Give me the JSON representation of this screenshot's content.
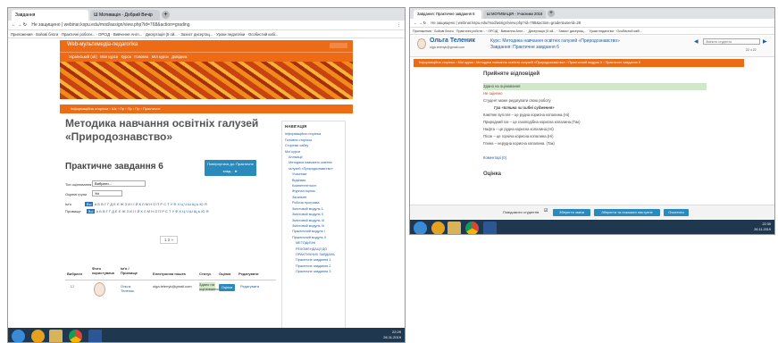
{
  "left": {
    "tabs": [
      "Завдання",
      "Ш Мотивація - Добрий Вечір"
    ],
    "url": "Не защищено | webinar.kspu.edu/mod/assign/view.php?id=768&action=grading",
    "bookmarks": [
      "Приложения",
      "Бойові блоги",
      "Практичні роботи...",
      "ОРСІД",
      "Вивчення Англ...",
      "Дисертація (5 ой...",
      "Захист дисертац...",
      "Уроки педагогіки",
      "Особистий кабі..."
    ],
    "site_title": "Web-мультимедіа-педагогіка",
    "nav": [
      "Український (uk)",
      "Моя курси",
      "Курси",
      "Головна",
      "Мої курси",
      "Довідник"
    ],
    "section_bar": [
      "Інформаційна сторінка",
      "Шк",
      "Пр",
      "Пр",
      "Пр",
      "Практичне"
    ],
    "course_title_1": "Методика навчання освітніх галузей",
    "course_title_2": "«Природознавство»",
    "assign_title": "Практичне завдання 6",
    "grade_button": "Повернутися до: Практичне завд... ►",
    "filter_label": "Тип оцінювання",
    "filter_value": "Вибрати...",
    "group_label": "Окремі групи",
    "group_value": "Усі",
    "firstname_label": "Ім'я",
    "surname_label": "Прізвище",
    "all_label": "Всі",
    "letters": "А Б В Г Ґ Д Е Є Ж З И І Ї Й К Л М Н О П Р С Т У Ф Х Ц Ч Ш Щ Ь Ю Я",
    "pager": "1  2  »",
    "table_headers": [
      "Вибрати",
      "Фото користувача",
      "Ім'я / Прізвище",
      "Електронна пошта",
      "Статус",
      "Оцінка",
      "Редагувати"
    ],
    "row": {
      "name": "Ольга Теленик",
      "email": "olga.telenyk@gmail.com",
      "status": "Здано на оцінювання",
      "grade_button": "Оцінка",
      "edit": "Редагувати"
    },
    "nav_block_title": "НАВІГАЦІЯ",
    "nav_block": [
      "Інформаційна сторінка",
      "Головна сторінка",
      "Сторінки сайту",
      "Мої курси",
      "Аплікації",
      "Методика навчання освітніх галузей «Природознавство»",
      "Учасники",
      "Відзнаки",
      "Компетентності",
      "Журнал оцінок",
      "Загальне",
      "Робоча програма",
      "Змістовий модуль 1",
      "Змістовий модуль ІІ",
      "Змістовий модуль ІІІ",
      "Змістовий модуль ІV",
      "Практичний модуль І",
      "Практичний модуль ІІ",
      "МЕТОДИЧНІ РЕКОМЕНДАЦІЇ ДО ПРАКТИЧНИХ ЗАВДАНЬ",
      "Практичне завдання 1",
      "Практичне завдання 2",
      "Практичне завдання 3"
    ],
    "clock": "22:29",
    "date": "26.11.2019"
  },
  "right": {
    "tabs": [
      "Завдання: Практичне завдання 6",
      "Ш МОТИВАЦІЯ - Учасники 2018"
    ],
    "url": "Не защищено | webinar.kspu.edu/mod/assign/view.php?id=768&action=grader&userid=28",
    "bookmarks": [
      "Приложения",
      "Бойові блоги",
      "Практичні роботи...",
      "ОРСІД",
      "Вивчення Англ...",
      "Дисертація (5 ой...",
      "Захист дисертац...",
      "Уроки педагогіки",
      "Особистий кабі..."
    ],
    "user_name": "Ольга Теленик",
    "user_email": "olga.telenyk@gmail.com",
    "course_line": "Курс: Методика навчання освітніх галузей «Природознавство»",
    "assign_line": "Завдання: Практичне завдання 6",
    "search_placeholder": "Змінити студента",
    "counter": "22 з 22",
    "bar": [
      "Інформаційна сторінка",
      "Мої курси",
      "Методика навчання освітніх галузей «Природознавство»",
      "Практичний модуль ІІ",
      "Практичне завдання 6"
    ],
    "section_title": "Прийняте відповідей",
    "status": "Здано на оцінювання",
    "not_graded": "Не оцінено",
    "edit_note": "Студент може редагувати свою роботу",
    "task_title": "Гра «Істина чи хибні судження»",
    "answers": [
      "Кам'яне вугілля – це рудна корисна копалина.(Ні)",
      "Природний газ – це газоподібна корисна копалина.(Так)",
      "Нафта – це рудна корисна копалина.(Ні)",
      "Пісок – це горюча корисна копалина.(Ні)",
      "Глина – нерудна корисна копалина. (Так)"
    ],
    "comments": "Коментарі (0)",
    "grade_title": "Оцінка",
    "notify_label": "Повідомити студентів",
    "btn_save": "Зберегти зміни",
    "btn_save_next": "Зберегти та показати наступне",
    "btn_reset": "Очистити",
    "clock": "22:30",
    "date": "26.11.2019"
  }
}
